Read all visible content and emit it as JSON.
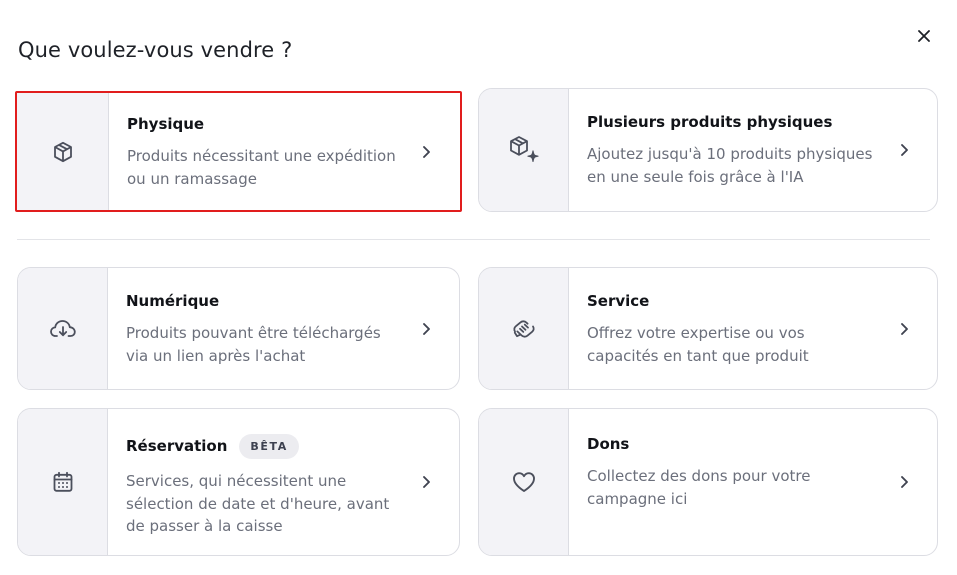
{
  "dialog": {
    "title": "Que voulez-vous vendre ?",
    "close_label": "×"
  },
  "options": [
    {
      "key": "physique",
      "title": "Physique",
      "description": "Produits nécessitant une expédition ou un ramassage",
      "icon": "box-icon",
      "selected": true
    },
    {
      "key": "plusieurs",
      "title": "Plusieurs produits physiques",
      "description": "Ajoutez jusqu'à 10 produits physiques en une seule fois grâce à l'IA",
      "icon": "box-sparkle-icon"
    },
    {
      "key": "numerique",
      "title": "Numérique",
      "description": "Produits pouvant être téléchargés via un lien après l'achat",
      "icon": "cloud-download-icon"
    },
    {
      "key": "service",
      "title": "Service",
      "description": "Offrez votre expertise ou vos capacités en tant que produit",
      "icon": "handshake-icon"
    },
    {
      "key": "reservation",
      "title": "Réservation",
      "badge": "BÊTA",
      "description": "Services, qui nécessitent une sélection de date et d'heure, avant de passer à la caisse",
      "icon": "calendar-icon"
    },
    {
      "key": "dons",
      "title": "Dons",
      "description": "Collectez des dons pour votre campagne ici",
      "icon": "heart-icon"
    }
  ],
  "colors": {
    "highlight": "#e11d1d",
    "icon_bg": "#f3f3f7",
    "muted_text": "#6b6f7b",
    "border": "#dcdde3"
  }
}
